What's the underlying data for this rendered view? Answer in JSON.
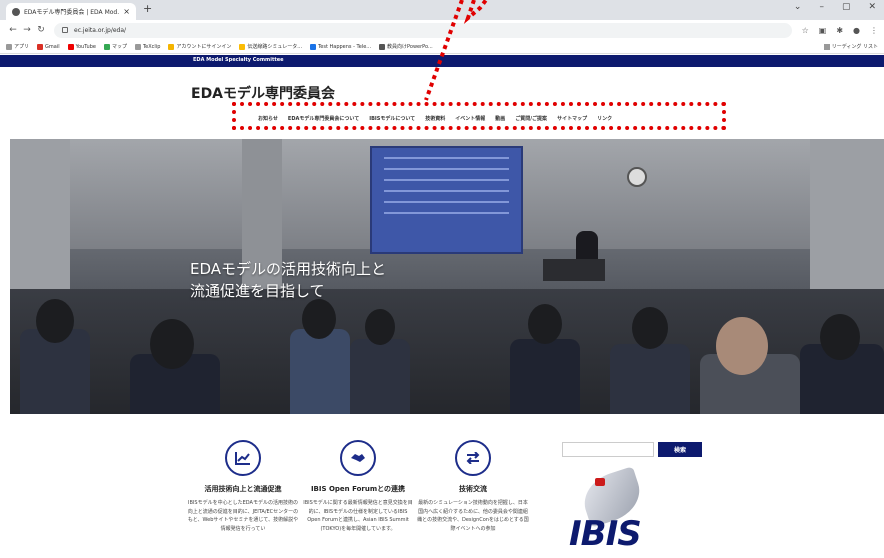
{
  "browser": {
    "tab_title": "EDAモデル専門委員会 | EDA Mod...",
    "tab_close": "×",
    "new_tab": "+",
    "url": "ec.jeita.or.jp/eda/",
    "bookmarks": [
      "アプリ",
      "Gmail",
      "YouTube",
      "マップ",
      "TeXclip",
      "アカウントにサインイン",
      "伝送線路シミュレータ...",
      "Test Happens - Tele...",
      "教員向けPowerPo..."
    ],
    "reading_list": "リーディング リスト"
  },
  "site": {
    "top_strip": "EDA Model Specialty Committee",
    "title": "EDAモデル専門委員会",
    "nav": [
      "お知らせ",
      "EDAモデル専門委員会について",
      "IBISモデルについて",
      "技術資料",
      "イベント情報",
      "動画",
      "ご質問/ご提案",
      "サイトマップ",
      "リンク"
    ],
    "hero_line1": "EDAモデルの活用技術向上と",
    "hero_line2": "流通促進を目指して",
    "features": [
      {
        "icon": "chart-icon",
        "title": "活用技術向上と流通促進",
        "text": "IBISモデルを中心としたEDAモデルの活用技術の向上と流通の促進を目的に、JEITA/ECセンターのもと、Webサイトやセミナを通じて、技術解説や情報発信を行ってい"
      },
      {
        "icon": "handshake-icon",
        "title": "IBIS Open Forumとの連携",
        "text": "IBISモデルに関する最新情報発信と意見交換を目的に、IBISモデルの仕様を制定しているIBIS Open Forumと連携し、Asian IBIS Summit (TOKYO)を毎年開催しています。"
      },
      {
        "icon": "exchange-icon",
        "title": "技術交流",
        "text": "最新のシミュレーション技術動向を把握し、日本国内へ広く紹介するために、他の委員会や関連組織との技術交流や、DesignConをはじめとする国際イベントへの参加"
      }
    ],
    "search_button": "検索",
    "search_placeholder": "",
    "logo_text": "IBIS"
  },
  "colors": {
    "navy": "#0d1a6e",
    "annotation_red": "#e00000"
  }
}
